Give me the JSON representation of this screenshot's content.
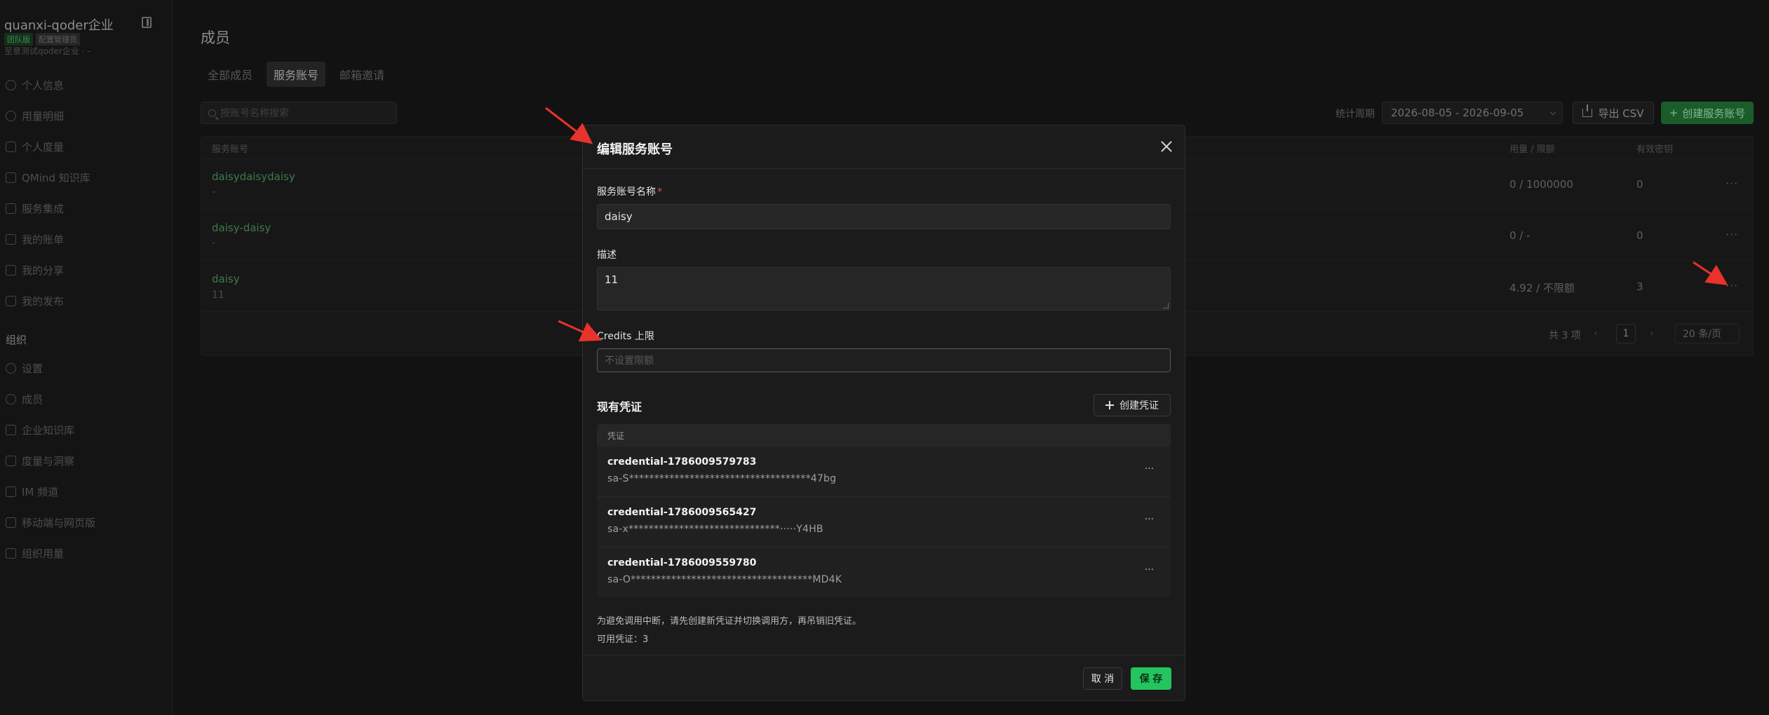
{
  "sidebar": {
    "org_name": "quanxi-qoder企业",
    "tag_plan": "团队版",
    "tag_role": "配置管理员",
    "org_sub": "至意测试qoder企业 · -",
    "personal_items": [
      {
        "label": "个人信息",
        "icon": "user-icon"
      },
      {
        "label": "用量明细",
        "icon": "chart-pie-icon"
      },
      {
        "label": "个人度量",
        "icon": "trend-icon"
      },
      {
        "label": "QMind 知识库",
        "icon": "book-icon"
      },
      {
        "label": "服务集成",
        "icon": "integration-icon"
      },
      {
        "label": "我的账单",
        "icon": "bill-icon"
      },
      {
        "label": "我的分享",
        "icon": "share-icon"
      },
      {
        "label": "我的发布",
        "icon": "publish-icon"
      }
    ],
    "org_section": "组织",
    "org_items": [
      {
        "label": "设置",
        "icon": "gear-icon"
      },
      {
        "label": "成员",
        "icon": "members-icon"
      },
      {
        "label": "企业知识库",
        "icon": "book-icon"
      },
      {
        "label": "度量与洞察",
        "icon": "insight-icon"
      },
      {
        "label": "IM 频道",
        "icon": "chat-icon"
      },
      {
        "label": "移动端与网页版",
        "icon": "mobile-icon"
      },
      {
        "label": "组织用量",
        "icon": "usage-icon"
      }
    ]
  },
  "main": {
    "title": "成员",
    "tabs": [
      "全部成员",
      "服务账号",
      "邮箱邀请"
    ],
    "search_placeholder": "按账号名称搜索",
    "period_label": "统计周期",
    "period_value": "2026-08-05 - 2026-09-05",
    "export_label": "导出 CSV",
    "create_label": "创建服务账号",
    "columns": {
      "account": "服务账号",
      "usage": "用量 / 限额",
      "keys": "有效密钥"
    },
    "rows": [
      {
        "name": "daisydaisydaisy",
        "desc": "-",
        "usage": "0 / 1000000",
        "keys": "0",
        "more": "···"
      },
      {
        "name": "daisy-daisy",
        "desc": "-",
        "usage": "0 / -",
        "keys": "0",
        "more": "···"
      },
      {
        "name": "daisy",
        "desc": "11",
        "usage": "4.92 / 不限额",
        "keys": "3",
        "more": "···"
      }
    ],
    "pagination": {
      "total": "共 3 项",
      "prev": "‹",
      "page": "1",
      "next": "›",
      "size": "20 条/页"
    }
  },
  "modal": {
    "title": "编辑服务账号",
    "name_label": "服务账号名称",
    "required_mark": "*",
    "name_value": "daisy",
    "desc_label": "描述",
    "desc_value": "11",
    "credits_label": "Credits 上限",
    "credits_placeholder": "不设置限额",
    "creds_title": "现有凭证",
    "new_cred_label": "创建凭证",
    "cred_col": "凭证",
    "credentials": [
      {
        "name": "credential-1786009579783",
        "secret": "sa-S************************************47bg",
        "more": "···"
      },
      {
        "name": "credential-1786009565427",
        "secret": "sa-x******************************·····Y4HB",
        "more": "···"
      },
      {
        "name": "credential-1786009559780",
        "secret": "sa-O************************************MD4K",
        "more": "···"
      }
    ],
    "hint": "为避免调用中断，请先创建新凭证并切换调用方，再吊销旧凭证。",
    "count": "可用凭证：3",
    "cancel_label": "取 消",
    "save_label": "保 存"
  },
  "colors": {
    "accent": "#22c55e",
    "arrow": "#e8322c",
    "link_green": "#3d7a4b"
  }
}
